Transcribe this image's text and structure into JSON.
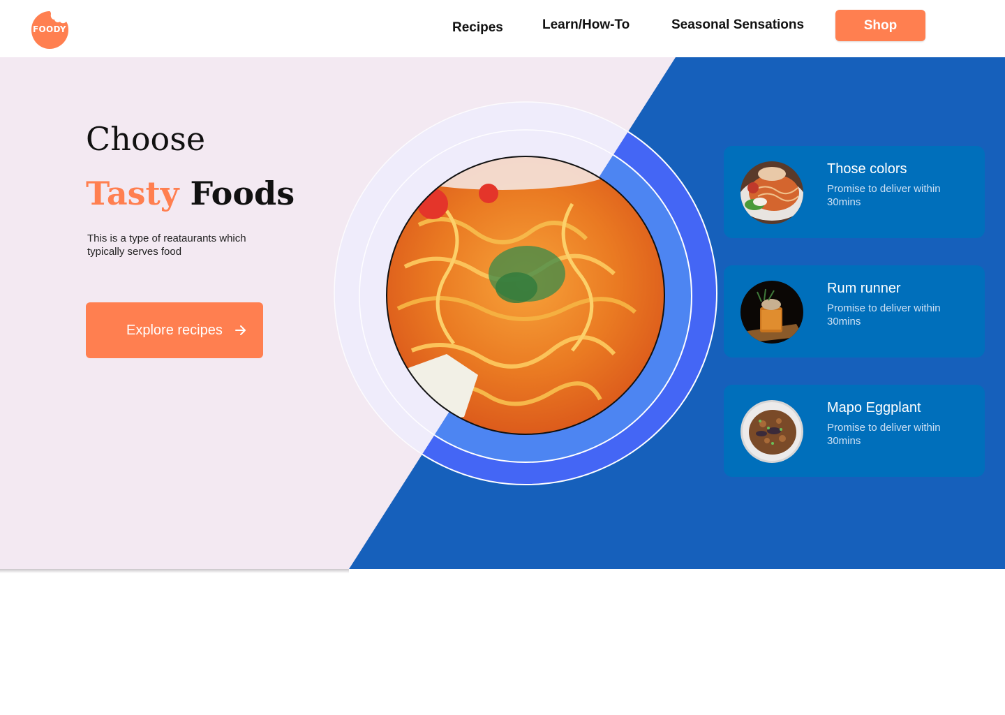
{
  "brand": {
    "logo_text": "FOODY",
    "accent": "#ff7f50",
    "primary_blue": "#1660bb",
    "card_blue": "#006fbb"
  },
  "nav": {
    "links": [
      {
        "label": "Recipes"
      },
      {
        "label": "Learn/How-To"
      },
      {
        "label": "Seasonal Sensations"
      }
    ],
    "shop_label": "Shop"
  },
  "hero": {
    "title_line1": "Choose",
    "title_highlight": "Tasty",
    "title_rest": "Foods",
    "subtitle": "This is a type of reataurants which typically serves food",
    "cta_label": "Explore recipes",
    "cta_icon": "arrow-right-icon",
    "main_image": "spaghetti-plate-image"
  },
  "cards": [
    {
      "title": "Those colors",
      "description": "Promise to deliver within 30mins",
      "image": "pasta-dish-image"
    },
    {
      "title": "Rum runner",
      "description": "Promise to deliver within 30mins",
      "image": "cocktail-glass-image"
    },
    {
      "title": "Mapo Eggplant",
      "description": "Promise to deliver within 30mins",
      "image": "eggplant-dish-image"
    }
  ]
}
